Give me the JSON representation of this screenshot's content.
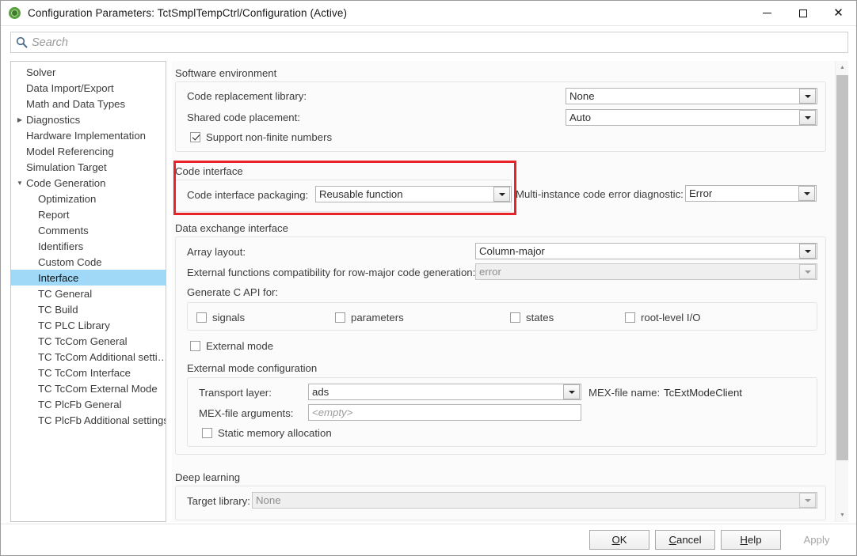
{
  "window": {
    "title": "Configuration Parameters: TctSmplTempCtrl/Configuration (Active)",
    "app_icon": "simulink-icon",
    "minimize_label": "—",
    "maximize_label": "□",
    "close_label": "✕"
  },
  "search": {
    "placeholder": "Search",
    "value": "",
    "icon": "search-icon"
  },
  "tree": {
    "items": [
      {
        "label": "Solver",
        "level": 0,
        "arrow": "none",
        "selected": false
      },
      {
        "label": "Data Import/Export",
        "level": 0,
        "arrow": "none",
        "selected": false
      },
      {
        "label": "Math and Data Types",
        "level": 0,
        "arrow": "none",
        "selected": false
      },
      {
        "label": "Diagnostics",
        "level": 0,
        "arrow": "collapsed",
        "selected": false
      },
      {
        "label": "Hardware Implementation",
        "level": 0,
        "arrow": "none",
        "selected": false
      },
      {
        "label": "Model Referencing",
        "level": 0,
        "arrow": "none",
        "selected": false
      },
      {
        "label": "Simulation Target",
        "level": 0,
        "arrow": "none",
        "selected": false
      },
      {
        "label": "Code Generation",
        "level": 0,
        "arrow": "expanded",
        "selected": false
      },
      {
        "label": "Optimization",
        "level": 1,
        "arrow": "none",
        "selected": false
      },
      {
        "label": "Report",
        "level": 1,
        "arrow": "none",
        "selected": false
      },
      {
        "label": "Comments",
        "level": 1,
        "arrow": "none",
        "selected": false
      },
      {
        "label": "Identifiers",
        "level": 1,
        "arrow": "none",
        "selected": false
      },
      {
        "label": "Custom Code",
        "level": 1,
        "arrow": "none",
        "selected": false
      },
      {
        "label": "Interface",
        "level": 1,
        "arrow": "none",
        "selected": true
      },
      {
        "label": "TC General",
        "level": 1,
        "arrow": "none",
        "selected": false
      },
      {
        "label": "TC Build",
        "level": 1,
        "arrow": "none",
        "selected": false
      },
      {
        "label": "TC PLC Library",
        "level": 1,
        "arrow": "none",
        "selected": false
      },
      {
        "label": "TC TcCom General",
        "level": 1,
        "arrow": "none",
        "selected": false
      },
      {
        "label": "TC TcCom Additional setti…",
        "level": 1,
        "arrow": "none",
        "selected": false
      },
      {
        "label": "TC TcCom Interface",
        "level": 1,
        "arrow": "none",
        "selected": false
      },
      {
        "label": "TC TcCom External Mode",
        "level": 1,
        "arrow": "none",
        "selected": false
      },
      {
        "label": "TC PlcFb General",
        "level": 1,
        "arrow": "none",
        "selected": false
      },
      {
        "label": "TC PlcFb Additional settings",
        "level": 1,
        "arrow": "none",
        "selected": false
      }
    ]
  },
  "software_environment": {
    "title": "Software environment",
    "code_replacement_library": {
      "label": "Code replacement library:",
      "value": "None"
    },
    "shared_code_placement": {
      "label": "Shared code placement:",
      "value": "Auto"
    },
    "support_non_finite_numbers": {
      "label": "Support non-finite numbers",
      "checked": true
    }
  },
  "code_interface": {
    "title": "Code interface",
    "highlight_color": "#e8232a",
    "code_interface_packaging": {
      "label": "Code interface packaging:",
      "value": "Reusable function"
    },
    "multi_instance_code_error_diagnostic": {
      "label": "Multi-instance code error diagnostic:",
      "value": "Error"
    }
  },
  "data_exchange_interface": {
    "title": "Data exchange interface",
    "array_layout": {
      "label": "Array layout:",
      "value": "Column-major"
    },
    "external_functions_compatibility": {
      "label": "External functions compatibility for row-major code generation:",
      "value": "error",
      "disabled": true
    },
    "generate_c_api": {
      "label": "Generate C API for:",
      "options": [
        {
          "label": "signals",
          "checked": false
        },
        {
          "label": "parameters",
          "checked": false
        },
        {
          "label": "states",
          "checked": false
        },
        {
          "label": "root-level I/O",
          "checked": false
        }
      ]
    },
    "external_mode": {
      "label": "External mode",
      "checked": false
    },
    "external_mode_configuration": {
      "title": "External mode configuration",
      "transport_layer": {
        "label": "Transport layer:",
        "value": "ads"
      },
      "mex_file_name": {
        "label": "MEX-file name:",
        "value": "TcExtModeClient"
      },
      "mex_file_arguments": {
        "label": "MEX-file arguments:",
        "placeholder": "<empty>",
        "value": ""
      },
      "static_memory_allocation": {
        "label": "Static memory allocation",
        "checked": false
      }
    }
  },
  "deep_learning": {
    "title": "Deep learning",
    "target_library": {
      "label": "Target library:",
      "value": "None",
      "disabled": true
    }
  },
  "footer": {
    "ok": "OK",
    "ok_mnemonic": "O",
    "cancel": "Cancel",
    "cancel_mnemonic": "C",
    "help": "Help",
    "help_mnemonic": "H",
    "apply": "Apply",
    "apply_disabled": true
  },
  "scrollbar": {
    "up_arrow": "▲",
    "down_arrow": "▼"
  }
}
